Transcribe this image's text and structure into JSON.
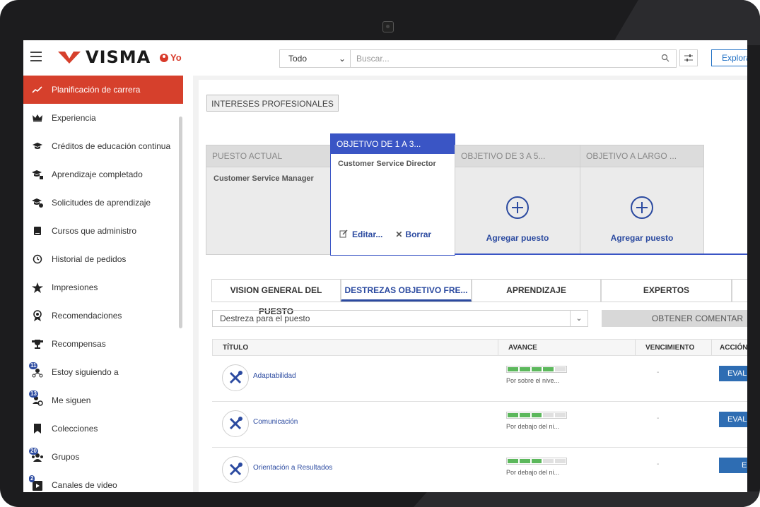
{
  "header": {
    "logo_text": "VISMA",
    "user_label": "Yo",
    "search_scope": "Todo",
    "search_placeholder": "Buscar...",
    "explore_label": "Explora"
  },
  "sidebar": {
    "items": [
      {
        "label": "Planificación de carrera",
        "icon": "trend-icon",
        "active": true
      },
      {
        "label": "Experiencia",
        "icon": "crown-icon"
      },
      {
        "label": "Créditos de educación continua",
        "icon": "graduation-cap-icon"
      },
      {
        "label": "Aprendizaje completado",
        "icon": "graduation-check-icon"
      },
      {
        "label": "Solicitudes de aprendizaje",
        "icon": "graduation-request-icon"
      },
      {
        "label": "Cursos que administro",
        "icon": "book-icon"
      },
      {
        "label": "Historial de pedidos",
        "icon": "history-icon"
      },
      {
        "label": "Impresiones",
        "icon": "star-icon"
      },
      {
        "label": "Recomendaciones",
        "icon": "ribbon-icon"
      },
      {
        "label": "Recompensas",
        "icon": "trophy-icon"
      },
      {
        "label": "Estoy siguiendo a",
        "icon": "following-icon",
        "badge": "11"
      },
      {
        "label": "Me siguen",
        "icon": "followers-icon",
        "badge": "13"
      },
      {
        "label": "Colecciones",
        "icon": "bookmark-icon"
      },
      {
        "label": "Grupos",
        "icon": "groups-icon",
        "badge": "20"
      },
      {
        "label": "Canales de video",
        "icon": "video-channel-icon",
        "badge": "2"
      }
    ]
  },
  "main": {
    "interests_button": "INTERESES PROFESIONALES",
    "cards": [
      {
        "head": "PUESTO ACTUAL",
        "job": "Customer Service Manager"
      },
      {
        "head": "OBJETIVO DE 1 A 3...",
        "job": "Customer Service Director",
        "edit": "Editar...",
        "delete": "Borrar"
      },
      {
        "head": "OBJETIVO DE 3 A 5...",
        "add": "Agregar puesto"
      },
      {
        "head": "OBJETIVO A LARGO ...",
        "add": "Agregar puesto"
      }
    ],
    "tabs": [
      "VISION GENERAL DEL PUESTO",
      "DESTREZAS OBJETIVO FRE...",
      "APRENDIZAJE",
      "EXPERTOS"
    ],
    "active_tab": 1,
    "skill_select": "Destreza para el puesto",
    "feedback_button": "OBTENER COMENTAR",
    "table": {
      "headers": [
        "TÍTULO",
        "AVANCE",
        "VENCIMIENTO",
        "ACCIÓN"
      ],
      "rows": [
        {
          "title": "Adaptabilidad",
          "progress_segments_filled": 4,
          "progress_segments_total": 5,
          "status": "Por sobre el nive...",
          "due": "-",
          "action": "EVAL"
        },
        {
          "title": "Comunicación",
          "progress_segments_filled": 3,
          "progress_segments_total": 5,
          "status": "Por debajo del ni...",
          "due": "-",
          "action": "EVAL"
        },
        {
          "title": "Orientación a Resultados",
          "progress_segments_filled": 3,
          "progress_segments_total": 5,
          "status": "Por debajo del ni...",
          "due": "-",
          "action": "E"
        }
      ]
    }
  },
  "colors": {
    "brand_red": "#d6402c",
    "accent_blue": "#3a55c5",
    "progress_green": "#5cb85c",
    "button_blue": "#2e6db3"
  }
}
